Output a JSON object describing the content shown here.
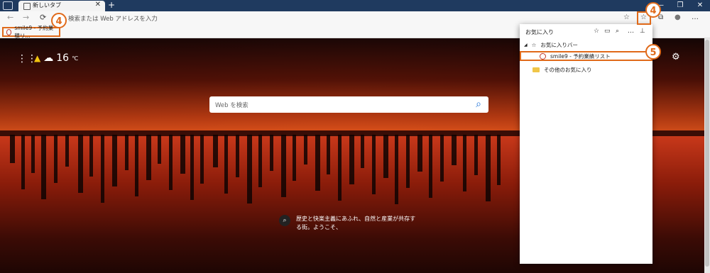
{
  "tab": {
    "label": "新しいタブ",
    "close": "✕"
  },
  "new_tab": "+",
  "window": {
    "minimize": "—",
    "restore": "❐",
    "close": "✕"
  },
  "toolbar": {
    "back": "←",
    "forward": "→",
    "refresh": "⟳",
    "address_placeholder": "検索または Web アドレスを入力",
    "add_favorite": "☆",
    "favorites": "☆",
    "collections": "⧉",
    "profile": "●",
    "more": "…"
  },
  "bookmarks_bar": {
    "item": "smile9 - 予約業積リ..."
  },
  "newtab_page": {
    "apps": "⋮⋮",
    "weather_temp": "16",
    "weather_unit": "℃",
    "search_placeholder": "Web を検索",
    "caption": "歴史と快楽主義にあふれ、自然と産業が共存する街。ようこそ、",
    "settings": "⚙"
  },
  "favorites_panel": {
    "title": "お気に入り",
    "favorites_bar_label": "お気に入りバー",
    "item_label": "smile9 - 予約業績リスト",
    "other_favorites_label": "その他のお気に入り"
  },
  "annotations": {
    "step4": "4",
    "step5": "5"
  },
  "colors": {
    "accent": "#e06a1a",
    "titlebar": "#1f3a5f",
    "search_icon": "#1a6fd6"
  }
}
